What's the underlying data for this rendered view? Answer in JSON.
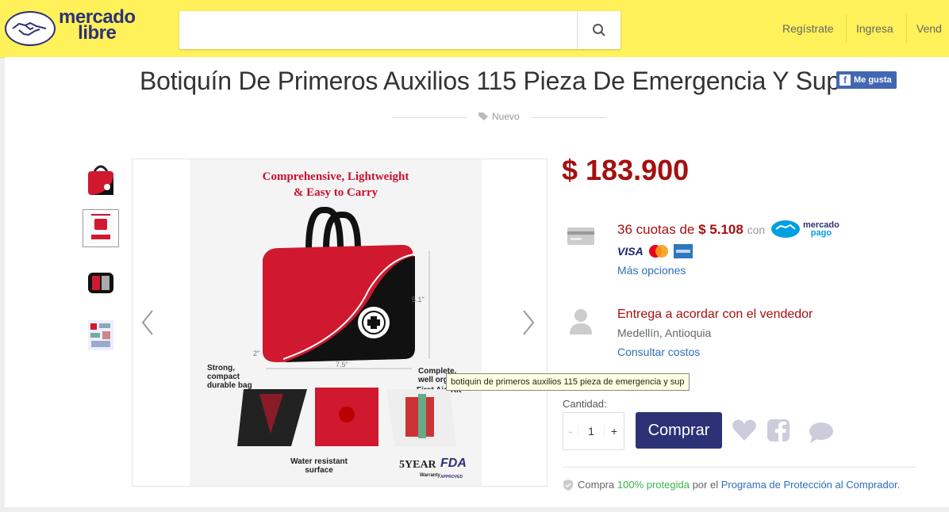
{
  "header": {
    "logo_line1": "mercado",
    "logo_line2": "libre",
    "search_placeholder": "",
    "nav": [
      "Regístrate",
      "Ingresa",
      "Vend"
    ]
  },
  "product": {
    "title": "Botiquín De Primeros Auxilios 115 Pieza De Emergencia Y Sup",
    "like_label": "Me gusta",
    "condition": "Nuevo",
    "price": "$ 183.900"
  },
  "image": {
    "heading_line1": "Comprehensive, Lightweight",
    "heading_line2": "& Easy to Carry",
    "label_strong": "Strong, compact durable bag",
    "label_complete": "Complete, well orga",
    "label_kit": "First Aid Kit",
    "label_water": "Water resistant surface",
    "dim_height": "5.1\"",
    "dim_width": "7.5\"",
    "dim_depth": "2\"",
    "badge_year": "5YEAR",
    "badge_warranty": "Warranty",
    "badge_fda": "FDA",
    "badge_approved": "APPROVED"
  },
  "tooltip": "botiquin de primeros auxilios 115 pieza de emergencia y sup",
  "payment": {
    "installments_prefix": "36 cuotas de",
    "installment_amount": "$ 5.108",
    "con": "con",
    "mp_line1": "mercado",
    "mp_line2": "pago",
    "visa": "VISA",
    "more_options": "Más opciones"
  },
  "shipping": {
    "title": "Entrega a acordar con el vendedor",
    "location": "Medellín, Antioquia",
    "costs_link": "Consultar costos"
  },
  "purchase": {
    "quantity_label": "Cantidad:",
    "quantity_minus": "-",
    "quantity_value": "1",
    "quantity_plus": "+",
    "buy_label": "Comprar"
  },
  "protection": {
    "prefix": "Compra",
    "percent": "100% protegida",
    "middle": "por el",
    "program": "Programa de Protección al Comprador."
  },
  "colors": {
    "header_bg": "#fff159",
    "brand_blue": "#2d3277",
    "price_red": "#a50f0f",
    "link_blue": "#2d6fb8",
    "green": "#39b54a"
  }
}
